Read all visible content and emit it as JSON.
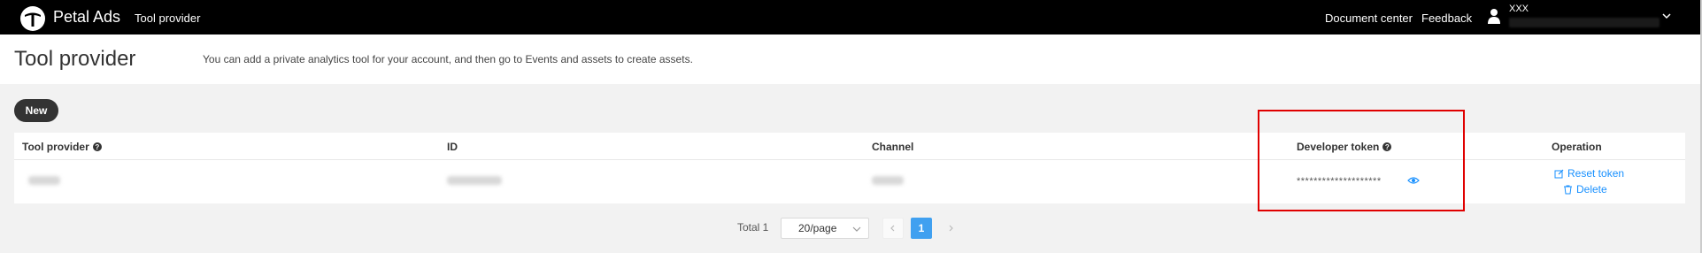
{
  "topbar": {
    "brand": "Petal Ads",
    "page": "Tool provider",
    "links": [
      "Document center",
      "Feedback"
    ],
    "user_name": "XXX"
  },
  "header": {
    "title": "Tool provider",
    "description": "You can add a private analytics tool for your account, and then go to Events and assets to create assets."
  },
  "toolbar": {
    "new_label": "New"
  },
  "table": {
    "columns": [
      "Tool provider",
      "ID",
      "Channel",
      "Developer token",
      "Operation"
    ],
    "rows": [
      {
        "developer_token": "********************",
        "operations": [
          "Reset token",
          "Delete"
        ]
      }
    ]
  },
  "pagination": {
    "total": "Total 1",
    "page_size": "20/page",
    "current_page": "1"
  },
  "colors": {
    "topbar_bg": "#000000",
    "accent": "#1890ff",
    "highlight": "#e00000"
  },
  "icons": {
    "logo": "petal-logo-icon",
    "user": "user-icon",
    "help": "help-icon",
    "eye": "eye-icon",
    "edit": "edit-icon",
    "trash": "trash-icon"
  }
}
